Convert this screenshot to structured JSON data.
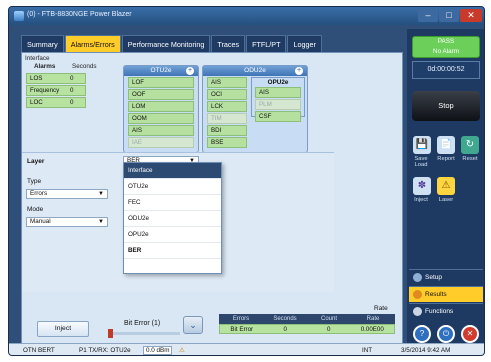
{
  "window": {
    "title": "(0) - FTB-8830NGE Power Blazer"
  },
  "tabs": [
    {
      "label": "Summary"
    },
    {
      "label": "Alarms/Errors"
    },
    {
      "label": "Performance Monitoring"
    },
    {
      "label": "Traces"
    },
    {
      "label": "FTFL/PT"
    },
    {
      "label": "Logger"
    }
  ],
  "interface_section": {
    "title": "Interface",
    "col_alarms": "Alarms",
    "col_seconds": "Seconds",
    "rows": [
      {
        "name": "LOS",
        "value": "0"
      },
      {
        "name": "Frequency",
        "value": "0"
      },
      {
        "name": "LOC",
        "value": "0"
      }
    ]
  },
  "otu2e_panel": {
    "title": "OTU2e",
    "items": [
      "LOF",
      "OOF",
      "LOM",
      "OOM",
      "AIS",
      "IAE"
    ]
  },
  "odu2e_panel": {
    "title": "ODU2e",
    "items": [
      "AIS",
      "OCI",
      "LCK",
      "TIM",
      "BDI",
      "BSE"
    ],
    "sub_title": "OPU2e",
    "sub_items": [
      "AIS",
      "PLM",
      "CSF"
    ]
  },
  "layer_settings": {
    "layer_label": "Layer",
    "layer_value": "BER",
    "type_label": "Type",
    "type_value": "Errors",
    "mode_label": "Mode",
    "mode_value": "Manual",
    "options": [
      "Interface",
      "OTU2e",
      "FEC",
      "ODU2e",
      "OPU2e",
      "BER"
    ]
  },
  "bottom": {
    "inject_label": "Inject",
    "bit_error_label": "Bit Error (1)",
    "rate_header": "Rate",
    "table_headers": [
      "Errors",
      "Seconds",
      "Count",
      "Rate"
    ],
    "table_row": [
      "Bit Error",
      "0",
      "0",
      "0.00E00"
    ]
  },
  "sidebar": {
    "alarm_pass": "PASS",
    "alarm_status": "No Alarm",
    "timer": "0d:00:00:52",
    "stop_label": "Stop",
    "save_load_label": "Save Load",
    "report_label": "Report",
    "reset_label": "Reset",
    "inject_label": "Inject",
    "laser_label": "Laser",
    "menu_setup": "Setup",
    "menu_results": "Results",
    "menu_functions": "Functions"
  },
  "statusbar": {
    "app": "OTN BERT",
    "port": "P1 TX/RX: OTU2e",
    "power": "0.0 dBm",
    "clock_src": "INT",
    "datetime": "3/5/2014 9:42 AM"
  },
  "colors": {
    "accent": "#ffcc2a",
    "alarm_pass": "#6ccf5a",
    "frame": "#2f4f78"
  }
}
